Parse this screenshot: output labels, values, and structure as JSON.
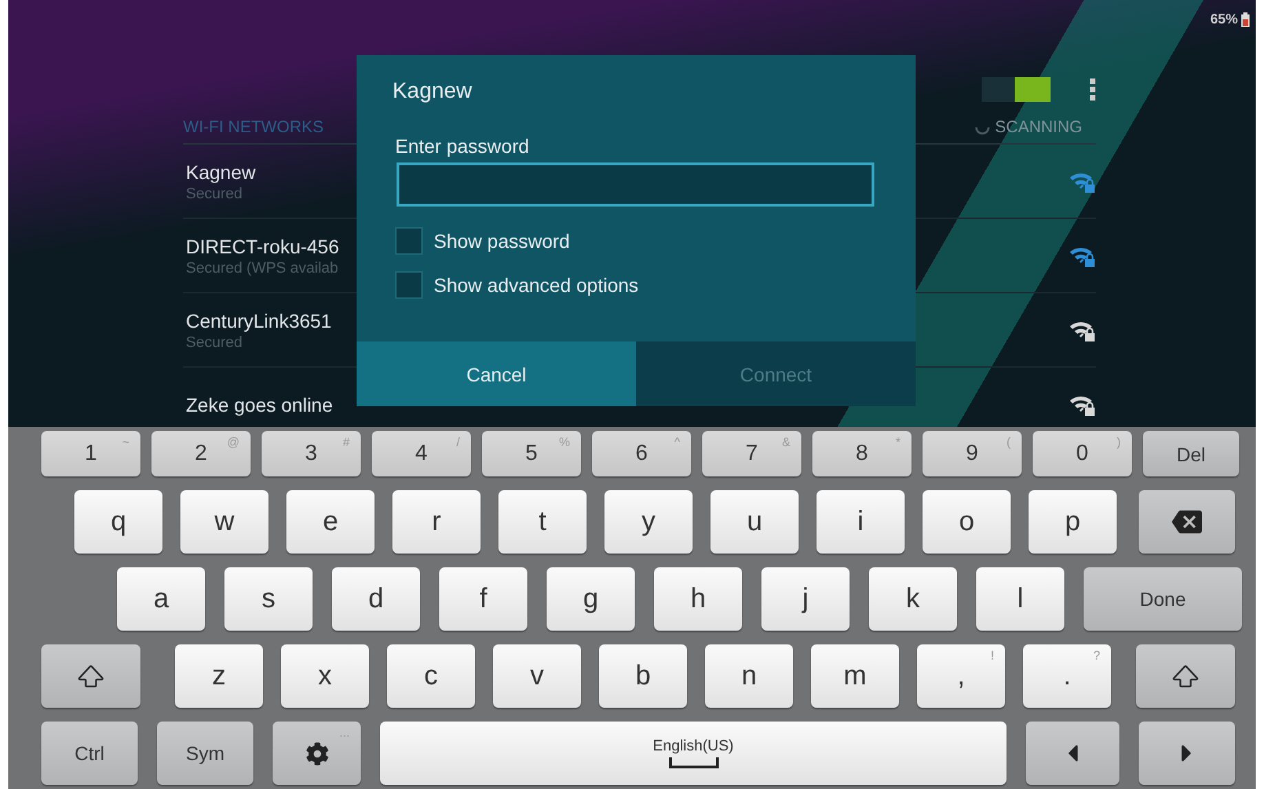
{
  "status_bar": {
    "battery": "65%"
  },
  "wifi_toggle": {
    "on": true
  },
  "wifi_list": {
    "header": "WI-FI NETWORKS",
    "scanning": "SCANNING",
    "networks": [
      {
        "name": "Kagnew",
        "status": "Secured",
        "color": "#2e8fd6"
      },
      {
        "name": "DIRECT-roku-456",
        "status": "Secured (WPS availab",
        "color": "#2e8fd6"
      },
      {
        "name": "CenturyLink3651",
        "status": "Secured",
        "color": "#d8d8d8"
      },
      {
        "name": "Zeke goes online",
        "color": "#d8d8d8"
      }
    ]
  },
  "dialog": {
    "title": "Kagnew",
    "field_label": "Enter password",
    "options": [
      {
        "label": "Show password",
        "checked": false
      },
      {
        "label": "Show advanced options",
        "checked": false
      }
    ],
    "buttons": [
      {
        "label": "Cancel",
        "disabled": false
      },
      {
        "label": "Connect",
        "disabled": true
      }
    ]
  },
  "keyboard": {
    "rows": [
      [
        {
          "kind": "num",
          "label": "1",
          "sub": "~"
        },
        {
          "kind": "num",
          "label": "2",
          "sub": "@"
        },
        {
          "kind": "num",
          "label": "3",
          "sub": "#"
        },
        {
          "kind": "num",
          "label": "4",
          "sub": "/"
        },
        {
          "kind": "num",
          "label": "5",
          "sub": "%"
        },
        {
          "kind": "num",
          "label": "6",
          "sub": "^"
        },
        {
          "kind": "num",
          "label": "7",
          "sub": "&"
        },
        {
          "kind": "num",
          "label": "8",
          "sub": "*"
        },
        {
          "kind": "num",
          "label": "9",
          "sub": "("
        },
        {
          "kind": "num",
          "label": "0",
          "sub": ")"
        },
        {
          "kind": "func",
          "label": "Del"
        }
      ],
      [
        {
          "kind": "char",
          "label": "q"
        },
        {
          "kind": "char",
          "label": "w"
        },
        {
          "kind": "char",
          "label": "e"
        },
        {
          "kind": "char",
          "label": "r"
        },
        {
          "kind": "char",
          "label": "t"
        },
        {
          "kind": "char",
          "label": "y"
        },
        {
          "kind": "char",
          "label": "u"
        },
        {
          "kind": "char",
          "label": "i"
        },
        {
          "kind": "char",
          "label": "o"
        },
        {
          "kind": "char",
          "label": "p"
        },
        {
          "kind": "backspace"
        }
      ],
      [
        {
          "kind": "char",
          "label": "a"
        },
        {
          "kind": "char",
          "label": "s"
        },
        {
          "kind": "char",
          "label": "d"
        },
        {
          "kind": "char",
          "label": "f"
        },
        {
          "kind": "char",
          "label": "g"
        },
        {
          "kind": "char",
          "label": "h"
        },
        {
          "kind": "char",
          "label": "j"
        },
        {
          "kind": "char",
          "label": "k"
        },
        {
          "kind": "char",
          "label": "l"
        },
        {
          "kind": "wide",
          "label": "Done"
        }
      ],
      [
        {
          "kind": "shift"
        },
        {
          "kind": "char",
          "label": "z"
        },
        {
          "kind": "char",
          "label": "x"
        },
        {
          "kind": "char",
          "label": "c"
        },
        {
          "kind": "char",
          "label": "v"
        },
        {
          "kind": "char",
          "label": "b"
        },
        {
          "kind": "char",
          "label": "n"
        },
        {
          "kind": "char",
          "label": "m"
        },
        {
          "kind": "char",
          "label": ",",
          "sub": "!"
        },
        {
          "kind": "char",
          "label": ".",
          "sub": "?"
        },
        {
          "kind": "shift"
        }
      ],
      [
        {
          "kind": "func",
          "label": "Ctrl"
        },
        {
          "kind": "func",
          "label": "Sym"
        },
        {
          "kind": "gear",
          "sub": "..."
        },
        {
          "kind": "space",
          "label": "English(US)"
        },
        {
          "kind": "left"
        },
        {
          "kind": "right"
        }
      ]
    ]
  }
}
